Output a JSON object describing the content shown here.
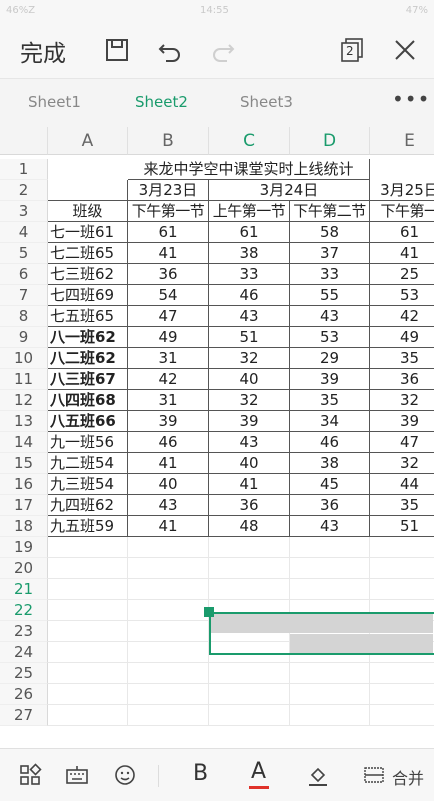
{
  "status": {
    "left": "46%Z",
    "time": "14:55",
    "battery": "47%"
  },
  "toolbar": {
    "done_label": "完成",
    "window_count": "2"
  },
  "tabs": [
    "Sheet1",
    "Sheet2",
    "Sheet3"
  ],
  "active_tab": 1,
  "columns": [
    "A",
    "B",
    "C",
    "D",
    "E"
  ],
  "selected_columns": [
    "C",
    "D"
  ],
  "selected_rows": [
    21,
    22
  ],
  "row_numbers": [
    1,
    2,
    3,
    4,
    5,
    6,
    7,
    8,
    9,
    10,
    11,
    12,
    13,
    14,
    15,
    16,
    17,
    18,
    19,
    20,
    21,
    22,
    23,
    24,
    25,
    26,
    27
  ],
  "sheet": {
    "title": "来龙中学空中课堂实时上线统计",
    "date1": "3月23日",
    "date2": "3月24日",
    "date3": "3月25日",
    "col_class": "班级",
    "period_b": "下午第一节",
    "period_c": "上午第一节",
    "period_d": "下午第二节",
    "period_e": "下午第一",
    "rows": [
      {
        "name": "七一班61",
        "b": "61",
        "c": "61",
        "d": "58",
        "e": "61",
        "bold": false
      },
      {
        "name": "七二班65",
        "b": "41",
        "c": "38",
        "d": "37",
        "e": "41",
        "bold": false
      },
      {
        "name": "七三班62",
        "b": "36",
        "c": "33",
        "d": "33",
        "e": "25",
        "bold": false
      },
      {
        "name": "七四班69",
        "b": "54",
        "c": "46",
        "d": "55",
        "e": "53",
        "bold": false
      },
      {
        "name": "七五班65",
        "b": "47",
        "c": "43",
        "d": "43",
        "e": "42",
        "bold": false
      },
      {
        "name": "八一班62",
        "b": "49",
        "c": "51",
        "d": "53",
        "e": "49",
        "bold": true
      },
      {
        "name": "八二班62",
        "b": "31",
        "c": "32",
        "d": "29",
        "e": "35",
        "bold": true
      },
      {
        "name": "八三班67",
        "b": "42",
        "c": "40",
        "d": "39",
        "e": "36",
        "bold": true
      },
      {
        "name": "八四班68",
        "b": "31",
        "c": "32",
        "d": "35",
        "e": "32",
        "bold": true
      },
      {
        "name": "八五班66",
        "b": "39",
        "c": "39",
        "d": "34",
        "e": "39",
        "bold": true
      },
      {
        "name": "九一班56",
        "b": "46",
        "c": "43",
        "d": "46",
        "e": "47",
        "bold": false
      },
      {
        "name": "九二班54",
        "b": "41",
        "c": "40",
        "d": "38",
        "e": "32",
        "bold": false
      },
      {
        "name": "九三班54",
        "b": "40",
        "c": "41",
        "d": "45",
        "e": "44",
        "bold": false
      },
      {
        "name": "九四班62",
        "b": "43",
        "c": "36",
        "d": "36",
        "e": "35",
        "bold": false
      },
      {
        "name": "九五班59",
        "b": "41",
        "c": "48",
        "d": "43",
        "e": "51",
        "bold": false
      }
    ]
  },
  "bottom": {
    "bold_label": "B",
    "font_color_label": "A",
    "merge_label": "合并"
  },
  "colors": {
    "accent": "#1a9b6c",
    "font_color_bar": "#e0322a"
  }
}
